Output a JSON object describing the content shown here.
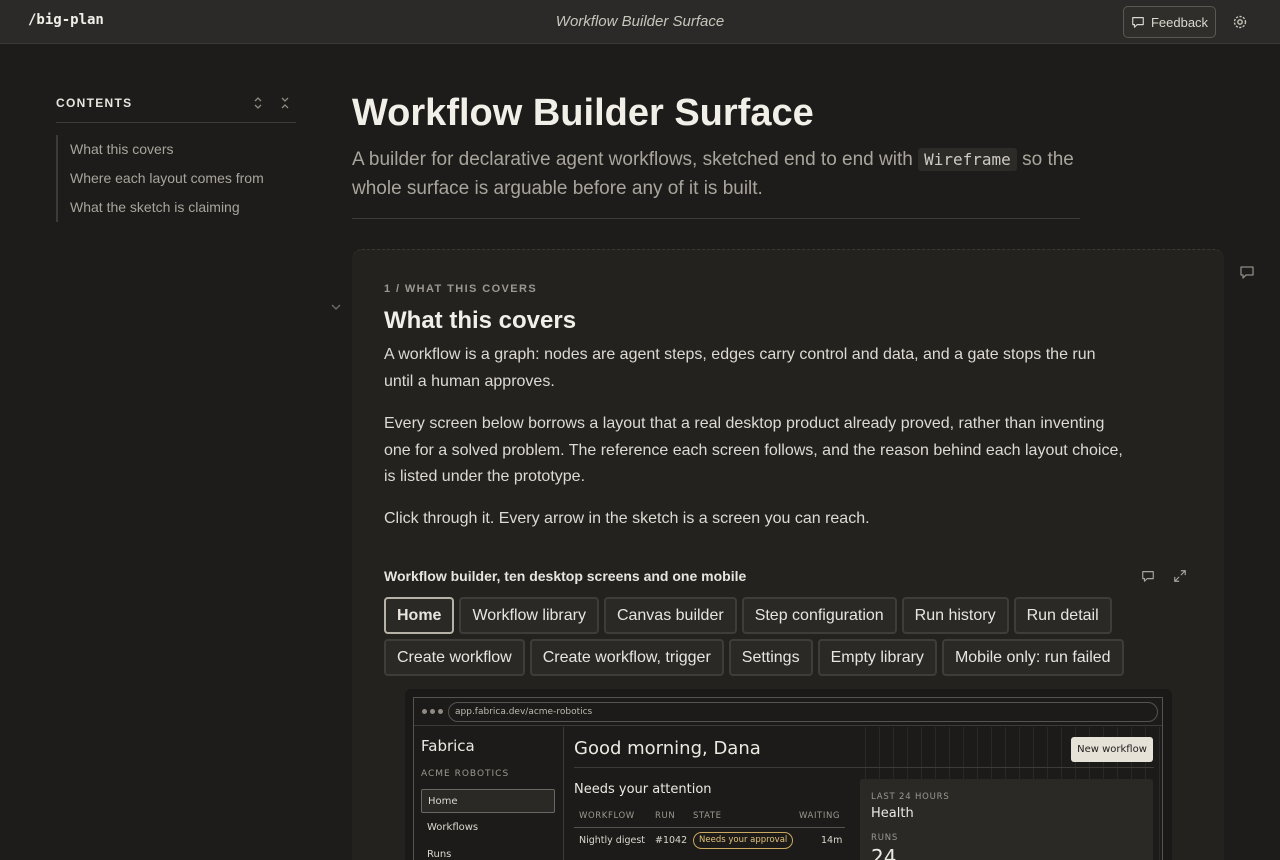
{
  "topbar": {
    "brand": "/big-plan",
    "title": "Workflow Builder Surface",
    "feedback_label": "Feedback"
  },
  "toc": {
    "title": "CONTENTS",
    "items": [
      {
        "label": "What this covers"
      },
      {
        "label": "Where each layout comes from"
      },
      {
        "label": "What the sketch is claiming"
      }
    ]
  },
  "header": {
    "title": "Workflow Builder Surface",
    "subtitle_before": "A builder for declarative agent workflows, sketched end to end with",
    "subtitle_code": "Wireframe",
    "subtitle_after": "so the whole surface is arguable before any of it is built."
  },
  "section": {
    "eyebrow": "1 / WHAT THIS COVERS",
    "title": "What this covers",
    "paragraphs": [
      "A workflow is a graph: nodes are agent steps, edges carry control and data, and a gate stops the run until a human approves.",
      "Every screen below borrows a layout that a real desktop product already proved, rather than inventing one for a solved problem. The reference each screen follows, and the reason behind each layout choice, is listed under the prototype.",
      "Click through it. Every arrow in the sketch is a screen you can reach."
    ]
  },
  "prototype": {
    "label": "Workflow builder, ten desktop screens and one mobile",
    "tabs_row1": [
      "Home",
      "Workflow library",
      "Canvas builder",
      "Step configuration",
      "Run history",
      "Run detail"
    ],
    "tabs_row2": [
      "Create workflow",
      "Create workflow, trigger",
      "Settings",
      "Empty library",
      "Mobile only: run failed"
    ],
    "active_tab": "Home"
  },
  "mock": {
    "url": "app.fabrica.dev/acme-robotics",
    "brand": "Fabrica",
    "org": "ACME ROBOTICS",
    "nav": [
      "Home",
      "Workflows",
      "Runs"
    ],
    "greeting": "Good morning, Dana",
    "new_button": "New workflow",
    "attention_title": "Needs your attention",
    "columns": [
      "WORKFLOW",
      "RUN",
      "STATE",
      "WAITING"
    ],
    "row": {
      "workflow": "Nightly digest",
      "run": "#1042",
      "state": "Needs your approval",
      "waiting": "14m"
    },
    "health": {
      "eyebrow": "LAST 24 HOURS",
      "title": "Health",
      "runs_label": "RUNS",
      "runs_value": "24"
    }
  },
  "colors": {
    "background": "#1d1c1a",
    "topbar": "#2b2a28",
    "card": "#23221f",
    "badge_accent": "#c9a85f"
  },
  "icons": [
    "comment-icon",
    "gear-icon",
    "expand-all-icon",
    "collapse-all-icon",
    "chevron-down-icon",
    "fullscreen-icon"
  ]
}
